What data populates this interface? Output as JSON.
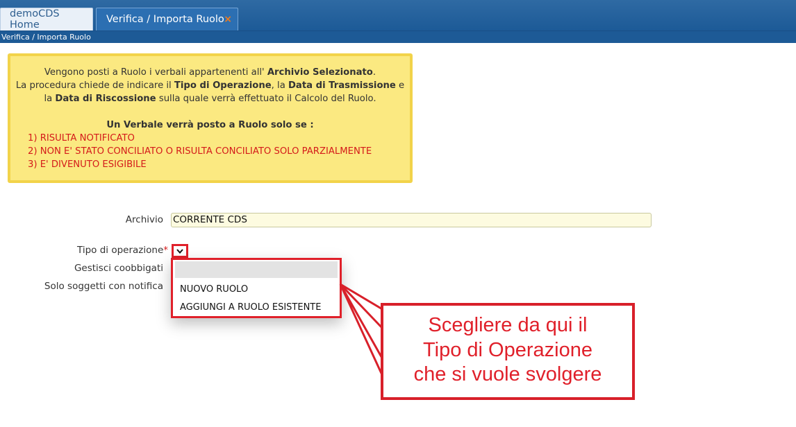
{
  "tabs": [
    {
      "label": "demoCDS Home"
    },
    {
      "label": "Verifica / Importa Ruolo",
      "close": "×"
    }
  ],
  "breadcrumb": "Verifica / Importa Ruolo",
  "info": {
    "line1_a": "Vengono posti a Ruolo i verbali appartenenti all' ",
    "line1_b": "Archivio Selezionato",
    "line1_c": ".",
    "line2_a": "La procedura chiede de indicare il ",
    "line2_b": "Tipo di Operazione",
    "line2_c": ", la ",
    "line2_d": "Data di Trasmissione",
    "line2_e": " e",
    "line3_a": "la ",
    "line3_b": "Data di Riscossione",
    "line3_c": " sulla quale verrà effettuato il Calcolo del Ruolo.",
    "heading": "Un Verbale verrà posto a Ruolo solo se :",
    "rules": [
      "1) RISULTA NOTIFICATO",
      "2) NON E' STATO CONCILIATO O RISULTA CONCILIATO SOLO PARZIALMENTE",
      "3) E' DIVENUTO ESIGIBILE"
    ]
  },
  "form": {
    "archivio_label": "Archivio",
    "archivio_value": "CORRENTE CDS",
    "tipo_label": "Tipo di operazione",
    "required_mark": "*",
    "coobbligati_label": "Gestisci coobbigati",
    "notifica_label": "Solo soggetti con notifica"
  },
  "dropdown": {
    "options": [
      "",
      "NUOVO RUOLO",
      "AGGIUNGI A RUOLO ESISTENTE"
    ]
  },
  "callout": {
    "lines": [
      "Scegliere da qui il",
      "Tipo di Operazione",
      "che si vuole svolgere"
    ]
  },
  "colors": {
    "accent_red": "#e0202a",
    "tab_blue": "#2c6fb2",
    "info_bg": "#fbe981"
  }
}
